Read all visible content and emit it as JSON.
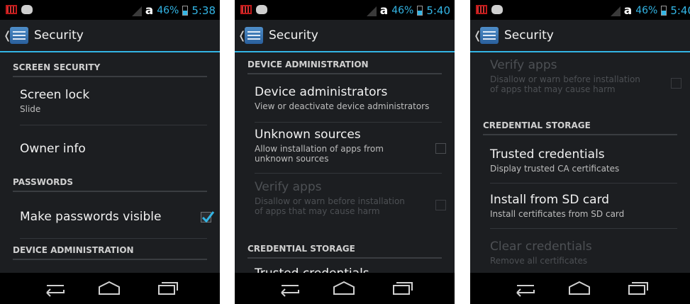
{
  "screens": [
    {
      "status": {
        "battery": "46%",
        "time": "5:38"
      },
      "title": "Security",
      "content": {
        "screen_security_header": "SCREEN SECURITY",
        "screen_lock_title": "Screen lock",
        "screen_lock_summary": "Slide",
        "owner_info_title": "Owner info",
        "passwords_header": "PASSWORDS",
        "make_passwords_visible_title": "Make passwords visible",
        "make_passwords_visible_checked": true,
        "device_admin_header": "DEVICE ADMINISTRATION"
      }
    },
    {
      "status": {
        "battery": "46%",
        "time": "5:40"
      },
      "title": "Security",
      "content": {
        "device_admin_header": "DEVICE ADMINISTRATION",
        "device_administrators_title": "Device administrators",
        "device_administrators_summary": "View or deactivate device administrators",
        "unknown_sources_title": "Unknown sources",
        "unknown_sources_summary": "Allow installation of apps from unknown sources",
        "unknown_sources_checked": false,
        "verify_apps_title": "Verify apps",
        "verify_apps_summary": "Disallow or warn before installation of apps that may cause harm",
        "credential_storage_header": "CREDENTIAL STORAGE",
        "trusted_credentials_title": "Trusted credentials"
      }
    },
    {
      "status": {
        "battery": "46%",
        "time": "5:40"
      },
      "title": "Security",
      "content": {
        "verify_apps_title": "Verify apps",
        "verify_apps_summary": "Disallow or warn before installation of apps that may cause harm",
        "credential_storage_header": "CREDENTIAL STORAGE",
        "trusted_credentials_title": "Trusted credentials",
        "trusted_credentials_summary": "Display trusted CA certificates",
        "install_sd_title": "Install from SD card",
        "install_sd_summary": "Install certificates from SD card",
        "clear_credentials_title": "Clear credentials",
        "clear_credentials_summary": "Remove all certificates"
      }
    }
  ],
  "colors": {
    "accent": "#33b5e5",
    "background": "#1c1e21",
    "disabled_text": "#4d5054"
  },
  "icons": {
    "status": [
      "notification-icon",
      "cat-icon",
      "signal-icon",
      "battery-icon"
    ],
    "actionbar": "settings-icon",
    "navigation": [
      "back-icon",
      "home-icon",
      "recent-apps-icon"
    ]
  }
}
